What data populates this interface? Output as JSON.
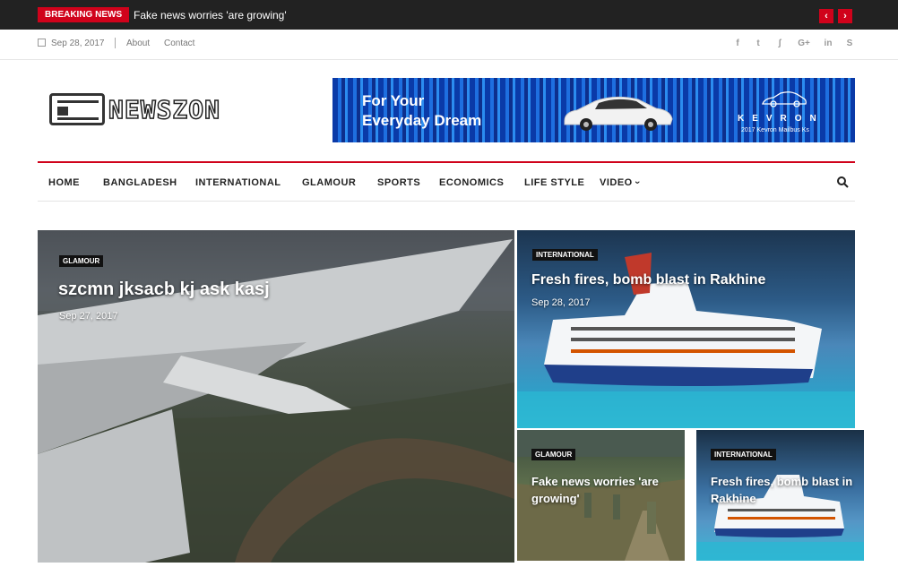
{
  "breaking": {
    "label": "BREAKING NEWS",
    "headline": "Fake news worries 'are growing'",
    "prev_icon": "‹",
    "next_icon": "›"
  },
  "topbar": {
    "date": "Sep 28, 2017",
    "links": [
      "About",
      "Contact"
    ],
    "social": [
      {
        "icon": "facebook-icon",
        "glyph": "f"
      },
      {
        "icon": "twitter-icon",
        "glyph": "t"
      },
      {
        "icon": "rss-icon",
        "glyph": "ʃ"
      },
      {
        "icon": "google-plus-icon",
        "glyph": "G+"
      },
      {
        "icon": "linkedin-icon",
        "glyph": "in"
      },
      {
        "icon": "skype-icon",
        "glyph": "S"
      }
    ]
  },
  "logo": {
    "text": "NEWSZON"
  },
  "ad": {
    "line1": "For Your",
    "line2": "Everyday Dream",
    "brand": "KEVRON",
    "brand_sub": "2017 Kevron Mailbus Ks"
  },
  "nav": {
    "items": [
      "HOME",
      "BANGLADESH",
      "INTERNATIONAL",
      "GLAMOUR",
      "SPORTS",
      "ECONOMICS",
      "LIFE STYLE",
      "VIDEO"
    ],
    "video_chevron": "›"
  },
  "colors": {
    "accent": "#d0021b",
    "dark": "#222222"
  },
  "cards": [
    {
      "tag": "GLAMOUR",
      "title": "szcmn jksacb kj ask kasj",
      "date": "Sep 27, 2017"
    },
    {
      "tag": "INTERNATIONAL",
      "title": "Fresh fires, bomb blast in Rakhine",
      "date": "Sep 28, 2017"
    },
    {
      "tag": "GLAMOUR",
      "title": "Fake news worries 'are growing'"
    },
    {
      "tag": "INTERNATIONAL",
      "title": "Fresh fires, bomb blast in Rakhine"
    }
  ]
}
